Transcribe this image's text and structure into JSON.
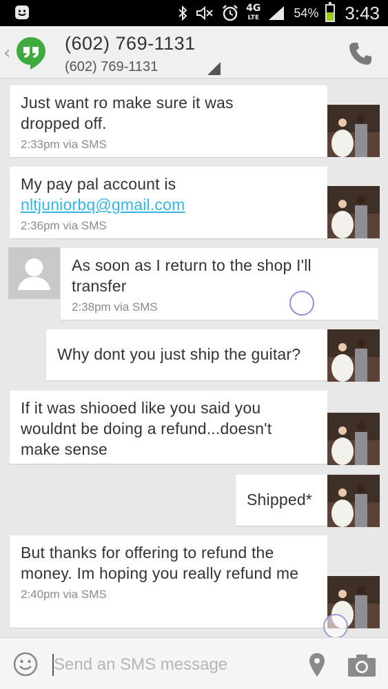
{
  "status_bar": {
    "battery_percent": "54%",
    "battery_level": 0.54,
    "time": "3:43",
    "network_top": "4G",
    "network_bottom": "LTE",
    "icons": [
      "bbm-icon",
      "bluetooth-icon",
      "mute-icon",
      "alarm-icon",
      "lte-icon",
      "signal-icon",
      "battery-icon"
    ]
  },
  "header": {
    "title": "(602) 769-1131",
    "subtitle": "(602) 769-1131",
    "app_icon": "hangouts-icon",
    "action_icon": "phone-icon"
  },
  "messages": [
    {
      "direction": "incoming-with-photo",
      "text": "Just want ro make sure it was dropped off.",
      "meta": "2:33pm via SMS"
    },
    {
      "direction": "incoming-with-photo",
      "text_before_link": "My pay pal account is",
      "link": "nltjuniorbq@gmail.com",
      "meta": "2:36pm via SMS"
    },
    {
      "direction": "outgoing",
      "text": "As soon as I return to the shop I'll transfer",
      "meta": "2:38pm via SMS"
    },
    {
      "direction": "incoming-with-photo",
      "text": "Why dont you just ship the guitar?",
      "meta": ""
    },
    {
      "direction": "incoming-with-photo",
      "text": "If it was shiooed like you said you wouldnt be doing a refund...doesn't make sense",
      "meta": ""
    },
    {
      "direction": "incoming-with-photo",
      "text": "Shipped*",
      "meta": ""
    },
    {
      "direction": "incoming-with-photo",
      "text": "But thanks for offering to refund the money. Im hoping you really refund me",
      "meta": "2:40pm via SMS"
    }
  ],
  "compose": {
    "placeholder": "Send an SMS message",
    "value": "",
    "icons": [
      "emoji-icon",
      "location-pin-icon",
      "camera-icon"
    ]
  },
  "colors": {
    "status_bar": "#000000",
    "header_bg": "#f0f0f0",
    "conversation_bg": "#e8e8e8",
    "bubble_bg": "#ffffff",
    "link": "#33b5e5",
    "hangouts_green": "#4caf50",
    "battery_fill": "#9ccc1a"
  }
}
